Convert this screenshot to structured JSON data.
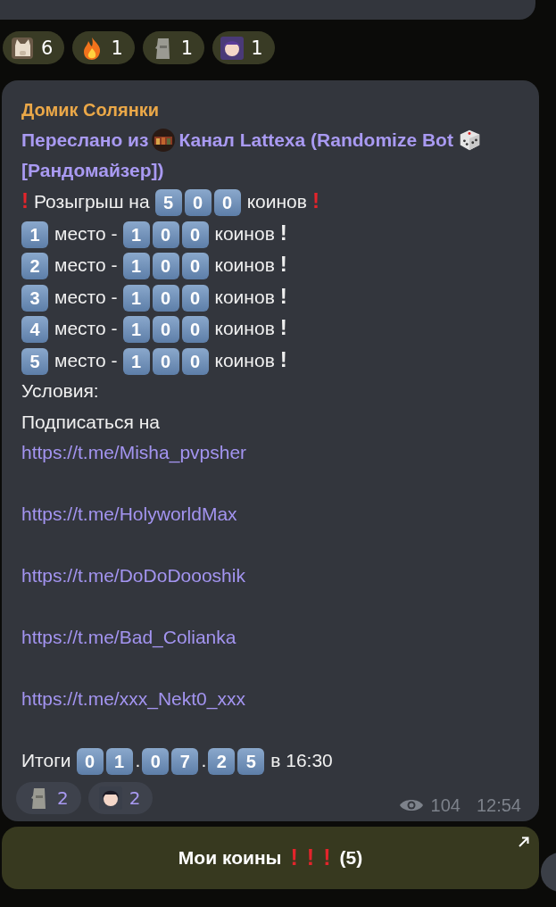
{
  "top_reactions": [
    {
      "kind": "cat",
      "count": "6"
    },
    {
      "kind": "fire",
      "count": "1"
    },
    {
      "kind": "moai",
      "count": "1"
    },
    {
      "kind": "anime",
      "count": "1"
    }
  ],
  "message": {
    "sender": "Домик Солянки",
    "forward": {
      "prefix": "Переслано из",
      "channel": "Канал Lattexa (Randomize Bot",
      "suffix": "[Рандомайзер])"
    },
    "lines": [
      {
        "segments": [
          {
            "kind": "mark",
            "text": "!",
            "color": "#e3242b"
          },
          {
            "kind": "text",
            "text": "Розыгрыш на"
          },
          {
            "kind": "key",
            "text": "5"
          },
          {
            "kind": "key",
            "text": "0"
          },
          {
            "kind": "key",
            "text": "0"
          },
          {
            "kind": "text",
            "text": "коинов"
          },
          {
            "kind": "mark",
            "text": "!",
            "color": "#e3242b"
          }
        ]
      },
      {
        "segments": [
          {
            "kind": "key",
            "text": "1"
          },
          {
            "kind": "text",
            "text": "место -"
          },
          {
            "kind": "key",
            "text": "1"
          },
          {
            "kind": "key",
            "text": "0"
          },
          {
            "kind": "key",
            "text": "0"
          },
          {
            "kind": "text",
            "text": "коинов"
          },
          {
            "kind": "mark",
            "text": "!",
            "color": "#eeeeee"
          }
        ]
      },
      {
        "segments": [
          {
            "kind": "key",
            "text": "2"
          },
          {
            "kind": "text",
            "text": "место -"
          },
          {
            "kind": "key",
            "text": "1"
          },
          {
            "kind": "key",
            "text": "0"
          },
          {
            "kind": "key",
            "text": "0"
          },
          {
            "kind": "text",
            "text": "коинов"
          },
          {
            "kind": "mark",
            "text": "!",
            "color": "#eeeeee"
          }
        ]
      },
      {
        "segments": [
          {
            "kind": "key",
            "text": "3"
          },
          {
            "kind": "text",
            "text": "место -"
          },
          {
            "kind": "key",
            "text": "1"
          },
          {
            "kind": "key",
            "text": "0"
          },
          {
            "kind": "key",
            "text": "0"
          },
          {
            "kind": "text",
            "text": "коинов"
          },
          {
            "kind": "mark",
            "text": "!",
            "color": "#eeeeee"
          }
        ]
      },
      {
        "segments": [
          {
            "kind": "key",
            "text": "4"
          },
          {
            "kind": "text",
            "text": "место -"
          },
          {
            "kind": "key",
            "text": "1"
          },
          {
            "kind": "key",
            "text": "0"
          },
          {
            "kind": "key",
            "text": "0"
          },
          {
            "kind": "text",
            "text": "коинов"
          },
          {
            "kind": "mark",
            "text": "!",
            "color": "#eeeeee"
          }
        ]
      },
      {
        "segments": [
          {
            "kind": "key",
            "text": "5"
          },
          {
            "kind": "text",
            "text": "место -"
          },
          {
            "kind": "key",
            "text": "1"
          },
          {
            "kind": "key",
            "text": "0"
          },
          {
            "kind": "key",
            "text": "0"
          },
          {
            "kind": "text",
            "text": "коинов"
          },
          {
            "kind": "mark",
            "text": "!",
            "color": "#eeeeee"
          }
        ]
      },
      {
        "segments": [
          {
            "kind": "text",
            "text": "Условия:"
          }
        ]
      },
      {
        "segments": [
          {
            "kind": "text",
            "text": "Подписаться на"
          }
        ]
      }
    ],
    "links": [
      "https://t.me/Misha_pvpsher",
      "https://t.me/HolyworldMax",
      "https://t.me/DoDoDoooshik",
      "https://t.me/Bad_Colianka",
      "https://t.me/xxx_Nekt0_xxx"
    ],
    "result": {
      "segments": [
        {
          "kind": "text",
          "text": "Итоги"
        },
        {
          "kind": "key",
          "text": "0"
        },
        {
          "kind": "key",
          "text": "1"
        },
        {
          "kind": "dot",
          "text": "."
        },
        {
          "kind": "key",
          "text": "0"
        },
        {
          "kind": "key",
          "text": "7"
        },
        {
          "kind": "dot",
          "text": "."
        },
        {
          "kind": "key",
          "text": "2"
        },
        {
          "kind": "key",
          "text": "5"
        },
        {
          "kind": "text",
          "text": "в 16:30"
        }
      ]
    },
    "reactions": [
      {
        "kind": "moai",
        "count": "2"
      },
      {
        "kind": "anime",
        "count": "2"
      }
    ],
    "views": "104",
    "time": "12:54"
  },
  "button": {
    "label": "Мои коины",
    "marks": [
      {
        "text": "!",
        "color": "#e3242b"
      },
      {
        "text": "!",
        "color": "#e3242b"
      },
      {
        "text": "!",
        "color": "#e3242b"
      }
    ],
    "count": "(5)"
  }
}
